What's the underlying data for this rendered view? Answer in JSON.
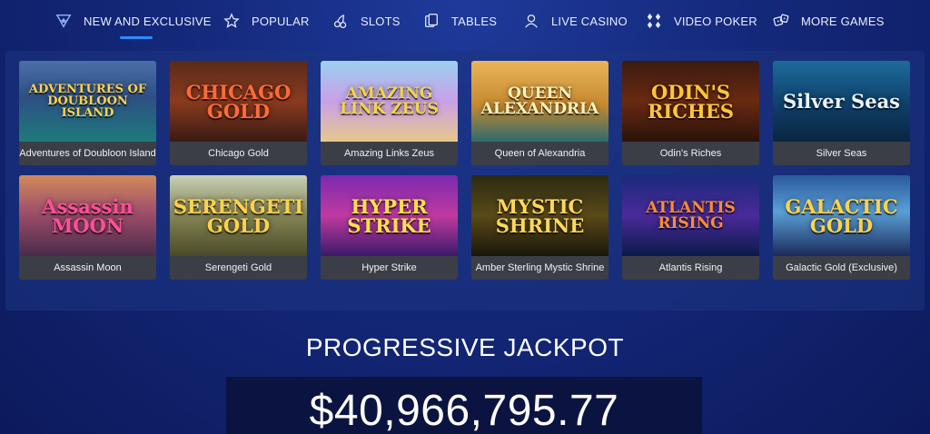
{
  "nav": [
    {
      "label": "NEW AND EXCLUSIVE",
      "icon": "star-badge-icon",
      "active": true
    },
    {
      "label": "POPULAR",
      "icon": "star-outline-icon",
      "active": false
    },
    {
      "label": "SLOTS",
      "icon": "cherries-icon",
      "active": false
    },
    {
      "label": "TABLES",
      "icon": "cards-icon",
      "active": false
    },
    {
      "label": "LIVE CASINO",
      "icon": "dealer-icon",
      "active": false
    },
    {
      "label": "VIDEO POKER",
      "icon": "diamond-grid-icon",
      "active": false
    },
    {
      "label": "MORE GAMES",
      "icon": "dice-icon",
      "active": false
    }
  ],
  "games": [
    {
      "name": "Adventures of Doubloon Island",
      "art": "ADVENTURES OF DOUBLOON ISLAND",
      "bg": "linear-gradient(180deg,#4a6fa8 0%,#2e4f84 45%,#1d7a7a 100%)",
      "color": "#ffd34d"
    },
    {
      "name": "Chicago Gold",
      "art": "CHICAGO GOLD",
      "bg": "linear-gradient(180deg,#5a2a1a 0%,#8a3b1e 50%,#3a1a12 100%)",
      "color": "#ff6a3a"
    },
    {
      "name": "Amazing Links Zeus",
      "art": "AMAZING LINK ZEUS",
      "bg": "linear-gradient(180deg,#9ad0f0 0%,#c9a0e8 50%,#e8c88a 100%)",
      "color": "#f6d44a"
    },
    {
      "name": "Queen of Alexandria",
      "art": "QUEEN ALEXANDRIA",
      "bg": "linear-gradient(180deg,#e9b55a 0%,#c7892e 55%,#2c6a70 100%)",
      "color": "#fff1b8"
    },
    {
      "name": "Odin's Riches",
      "art": "ODIN'S RICHES",
      "bg": "linear-gradient(180deg,#3b1a10 0%,#6a2a12 50%,#2a120a 100%)",
      "color": "#ffc53a"
    },
    {
      "name": "Silver Seas",
      "art": "Silver Seas",
      "bg": "linear-gradient(180deg,#1b6b9a 0%,#0f3f6a 55%,#0a2540 100%)",
      "color": "#e7f4ff"
    },
    {
      "name": "Assassin Moon",
      "art": "Assassin MOON",
      "bg": "linear-gradient(180deg,#d08a5a 0%,#a0506a 45%,#4a2a4a 100%)",
      "color": "#ff4f9a"
    },
    {
      "name": "Serengeti Gold",
      "art": "SERENGETI GOLD",
      "bg": "linear-gradient(180deg,#c8d0b8 0%,#8a8a5a 45%,#4a4a28 100%)",
      "color": "#ffd24a"
    },
    {
      "name": "Hyper Strike",
      "art": "HYPER STRIKE",
      "bg": "linear-gradient(180deg,#7a2ab0 0%,#c03aa0 50%,#3a1a6a 100%)",
      "color": "#ffe04a"
    },
    {
      "name": "Amber Sterling Mystic Shrine",
      "art": "MYSTIC SHRINE",
      "bg": "linear-gradient(180deg,#2a2a12 0%,#5a4a18 50%,#1a160a 100%)",
      "color": "#ffd85a"
    },
    {
      "name": "Atlantis Rising",
      "art": "ATLANTIS RISING",
      "bg": "linear-gradient(180deg,#1a2a7a 0%,#4a2a9a 50%,#0a1a4a 100%)",
      "color": "#ff8a3a"
    },
    {
      "name": "Galactic Gold (Exclusive)",
      "art": "GALACTIC GOLD",
      "bg": "linear-gradient(180deg,#2a5a9a 0%,#5aa0d8 45%,#1a2a5a 100%)",
      "color": "#ffd24a"
    }
  ],
  "jackpot": {
    "title": "PROGRESSIVE JACKPOT",
    "amount": "$40,966,795.77"
  }
}
